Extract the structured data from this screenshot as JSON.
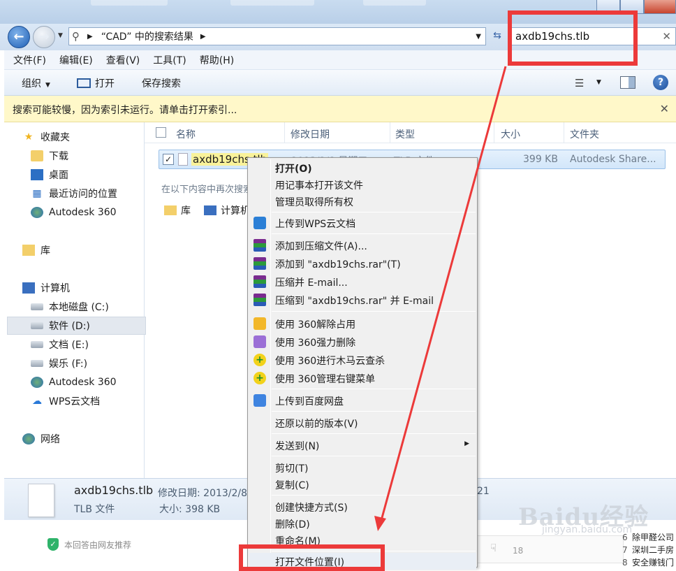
{
  "address": {
    "breadcrumb": "“CAD” 中的搜索结果",
    "search_value": "axdb19chs.tlb"
  },
  "menubar": {
    "items": [
      "文件(F)",
      "编辑(E)",
      "查看(V)",
      "工具(T)",
      "帮助(H)"
    ]
  },
  "toolbar": {
    "organize": "组织",
    "open": "打开",
    "save_search": "保存搜索"
  },
  "infobar": {
    "text": "搜索可能较慢，因为索引未运行。请单击打开索引..."
  },
  "sidebar": {
    "favorites": "收藏夹",
    "downloads": "下载",
    "desktop": "桌面",
    "recent": "最近访问的位置",
    "autodesk_fav": "Autodesk 360",
    "libraries": "库",
    "computer": "计算机",
    "drive_c": "本地磁盘 (C:)",
    "drive_d": "软件 (D:)",
    "drive_e": "文档 (E:)",
    "drive_f": "娱乐 (F:)",
    "autodesk_pc": "Autodesk 360",
    "wps_cloud": "WPS云文档",
    "network": "网络"
  },
  "columns": {
    "name": "名称",
    "modified": "修改日期",
    "type": "类型",
    "size": "大小",
    "folder": "文件夹"
  },
  "file": {
    "name": "axdb19chs.tlb",
    "date": "2013/2/8 星期五",
    "type": "TLB 文件",
    "size": "399 KB",
    "folder": "Autodesk Share..."
  },
  "search_again": {
    "label": "在以下内容中再次搜索:",
    "lib": "库",
    "pc": "计算机"
  },
  "details": {
    "name": "axdb19chs.tlb",
    "type": "TLB 文件",
    "modified_label": "修改日期: 2013/2/8",
    "size_label": "大小: 398 KB",
    "extra": "21"
  },
  "context_menu": {
    "open": "打开(O)",
    "open_notepad": "用记事本打开该文件",
    "take_ownership": "管理员取得所有权",
    "upload_wps": "上传到WPS云文档",
    "add_archive": "添加到压缩文件(A)...",
    "add_rar": "添加到 \"axdb19chs.rar\"(T)",
    "compress_email": "压缩并 E-mail...",
    "compress_rar_email": "压缩到 \"axdb19chs.rar\" 并 E-mail",
    "p360_unlock": "使用 360解除占用",
    "p360_delete": "使用 360强力删除",
    "p360_scan": "使用 360进行木马云查杀",
    "p360_menu": "使用 360管理右键菜单",
    "upload_baidu": "上传到百度网盘",
    "restore": "还原以前的版本(V)",
    "send_to": "发送到(N)",
    "cut": "剪切(T)",
    "copy": "复制(C)",
    "shortcut": "创建快捷方式(S)",
    "delete": "删除(D)",
    "rename": "重命名(M)",
    "open_location": "打开文件位置(I)"
  },
  "bottom": {
    "recommend": "本回答由网友推荐",
    "count": "18",
    "list": [
      {
        "n": "6",
        "t": "除甲醛公司"
      },
      {
        "n": "7",
        "t": "深圳二手房"
      },
      {
        "n": "8",
        "t": "安全赚钱门"
      }
    ]
  },
  "watermark": {
    "brand": "Baidu经验",
    "url": "jingyan.baidu.com"
  },
  "colors": {
    "annotation_red": "#ec3a3a",
    "selection_blue": "#d2e6fa",
    "infobar_yellow": "#fff8c9"
  }
}
